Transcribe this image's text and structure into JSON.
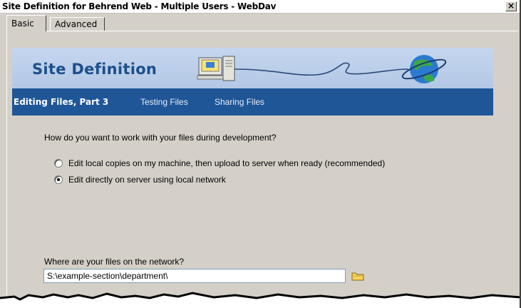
{
  "window": {
    "title": "Site Definition for Behrend Web - Multiple Users - WebDav",
    "close_label": "×"
  },
  "tabs": [
    {
      "label": "Basic",
      "active": true
    },
    {
      "label": "Advanced",
      "active": false
    }
  ],
  "banner": {
    "title": "Site Definition",
    "colors": {
      "title": "#1c4f8a",
      "background": "#c5d6ee"
    }
  },
  "nav": {
    "items": [
      {
        "label": "Editing Files, Part 3",
        "current": true
      },
      {
        "label": "Testing Files",
        "current": false
      },
      {
        "label": "Sharing Files",
        "current": false
      }
    ],
    "background": "#1f5697"
  },
  "form": {
    "question": "How do you want to work with your files during development?",
    "options": [
      {
        "label": "Edit local copies on my machine, then upload to server when ready (recommended)",
        "checked": false
      },
      {
        "label": "Edit directly on server using local network",
        "checked": true
      }
    ],
    "path_label": "Where are your files on the network?",
    "path_value": "S:\\example-section\\department\\",
    "browse_icon": "folder-icon"
  }
}
